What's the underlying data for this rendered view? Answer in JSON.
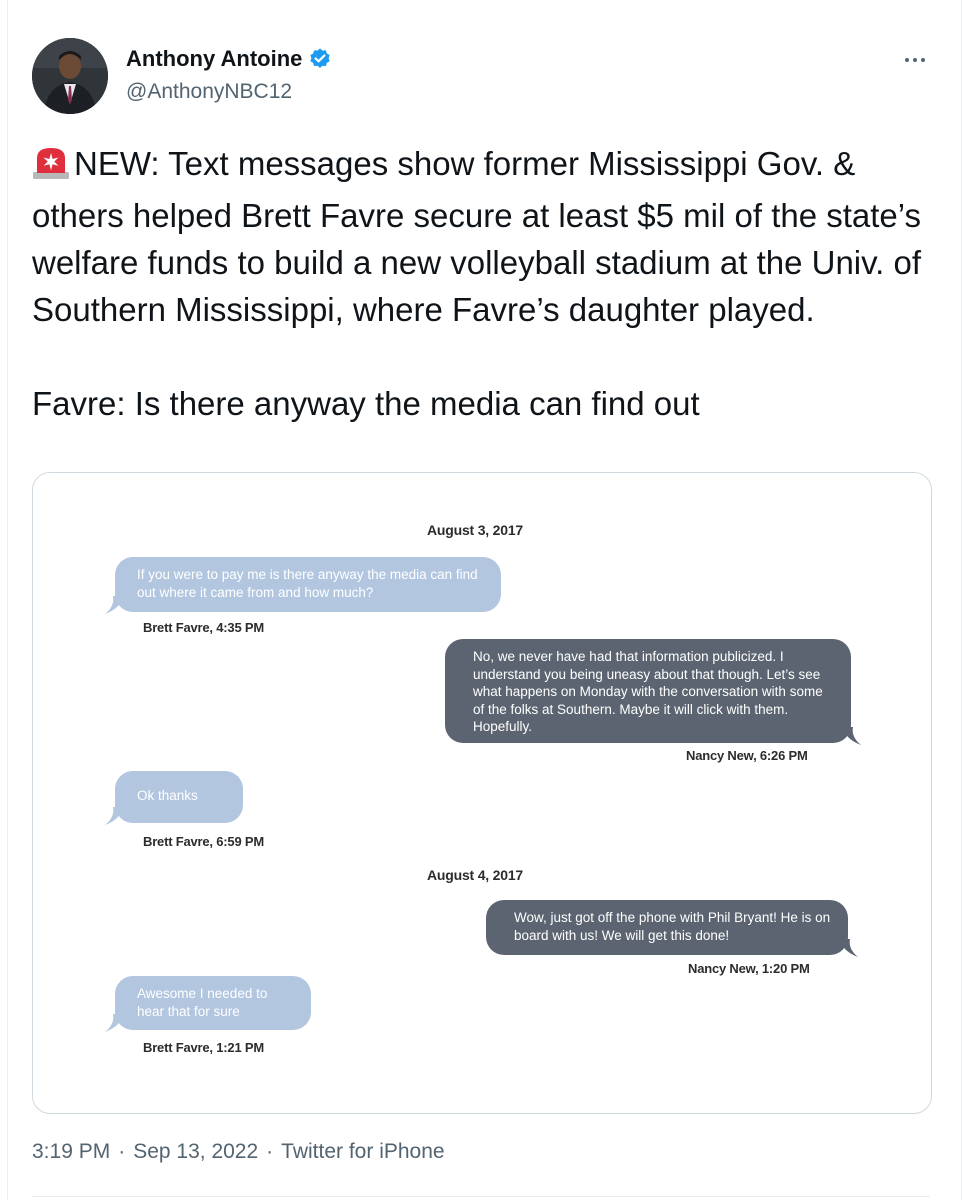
{
  "author": {
    "name": "Anthony Antoine",
    "handle": "@AnthonyNBC12",
    "verified": true
  },
  "tweet": {
    "text": "NEW: Text messages show former Mississippi Gov. & others helped Brett Favre secure at least $5 mil of the state’s welfare funds to build a new volleyball stadium at the Univ. of Southern Mississippi, where Favre’s daughter played.\n\nFavre: Is there anyway the media can find out"
  },
  "media": {
    "dates": [
      "August 3, 2017",
      "August 4, 2017"
    ],
    "messages": [
      {
        "text": "If you were to pay me is there anyway the media can find out where it came from and how much?",
        "sender": "Brett Favre, 4:35 PM"
      },
      {
        "text": "No, we never have had that information publicized. I understand you being uneasy about that though. Let’s see what happens on Monday with the conversation with some of the folks at Southern. Maybe it will click with them. Hopefully.",
        "sender": "Nancy New, 6:26 PM"
      },
      {
        "text": "Ok thanks",
        "sender": "Brett Favre, 6:59 PM"
      },
      {
        "text": "Wow, just got off the phone with Phil Bryant! He is on board with us! We will get this done!",
        "sender": "Nancy New, 1:20 PM"
      },
      {
        "text": "Awesome I  needed to hear that for sure",
        "sender": "Brett Favre, 1:21 PM"
      }
    ]
  },
  "meta": {
    "time": "3:19 PM",
    "date": "Sep 13, 2022",
    "source": "Twitter for iPhone",
    "separator": "·"
  },
  "colors": {
    "incoming_bubble": "#b2c6e0",
    "outgoing_bubble": "#5b6470",
    "verified": "#1d9bf0"
  }
}
